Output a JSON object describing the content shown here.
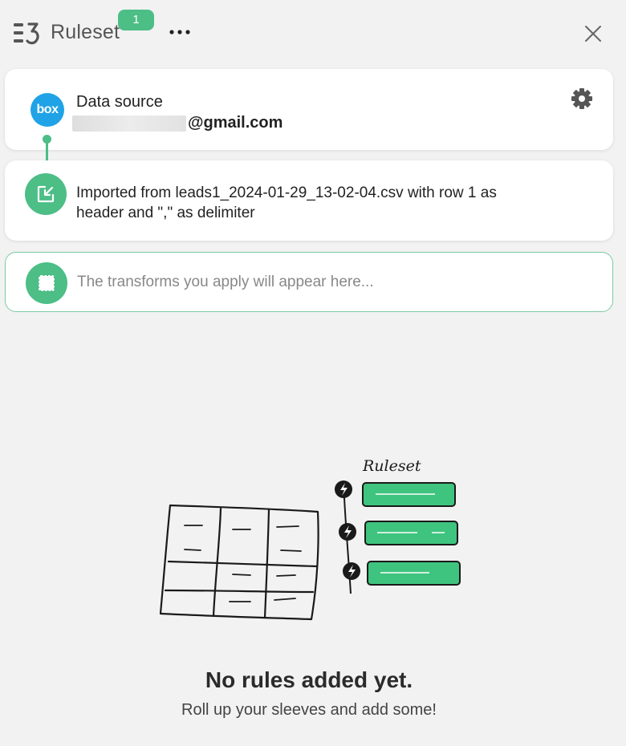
{
  "header": {
    "title": "Ruleset",
    "badge_count": "1",
    "more_label": "•••"
  },
  "source_card": {
    "logo_text": "box",
    "label": "Data source",
    "email_suffix": "@gmail.com"
  },
  "import_card": {
    "text": "Imported from leads1_2024-01-29_13-02-04.csv with row 1 as header and \",\" as delimiter"
  },
  "transform_card": {
    "placeholder": "The transforms you apply will appear here..."
  },
  "illustration": {
    "label": "Ruleset"
  },
  "empty_state": {
    "title": "No rules added yet.",
    "subtitle": "Roll up your sleeves and add some!"
  },
  "colors": {
    "accent": "#4cbe86",
    "box_blue": "#1fa3e6",
    "background": "#f2f2f2"
  }
}
